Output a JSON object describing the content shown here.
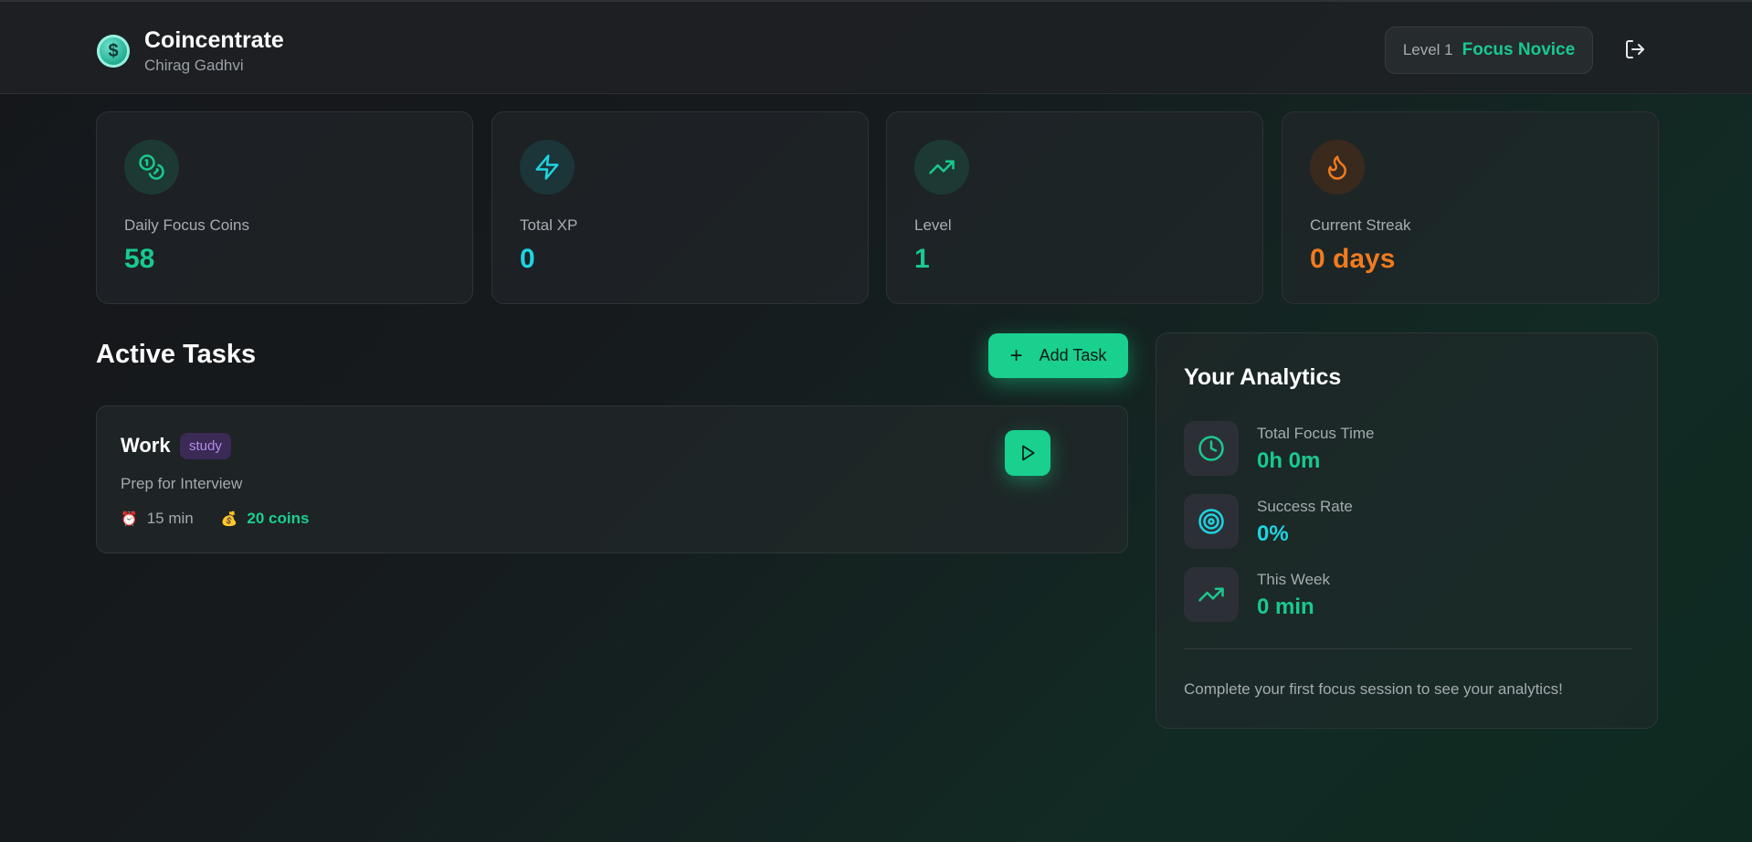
{
  "app": {
    "title": "Coincentrate",
    "user": "Chirag Gadhvi"
  },
  "header": {
    "level_label": "Level 1",
    "rank": "Focus Novice"
  },
  "stats": [
    {
      "label": "Daily Focus Coins",
      "value": "58",
      "color": "#19c98f",
      "icon": "coins-icon"
    },
    {
      "label": "Total XP",
      "value": "0",
      "color": "#1ed4e0",
      "icon": "lightning-icon"
    },
    {
      "label": "Level",
      "value": "1",
      "color": "#19c98f",
      "icon": "trending-up-icon"
    },
    {
      "label": "Current Streak",
      "value": "0 days",
      "color": "#f07b1e",
      "icon": "flame-icon"
    }
  ],
  "tasks_section": {
    "title": "Active Tasks",
    "add_label": "Add Task"
  },
  "tasks": [
    {
      "title": "Work",
      "tag": "study",
      "description": "Prep for Interview",
      "duration": "15 min",
      "coins": "20 coins"
    }
  ],
  "analytics": {
    "title": "Your Analytics",
    "metrics": [
      {
        "label": "Total Focus Time",
        "value": "0h 0m",
        "color": "#19c98f",
        "icon": "clock-icon"
      },
      {
        "label": "Success Rate",
        "value": "0%",
        "color": "#1ed4e0",
        "icon": "target-icon"
      },
      {
        "label": "This Week",
        "value": "0 min",
        "color": "#19c98f",
        "icon": "trending-up-icon"
      }
    ],
    "footer": "Complete your first focus session to see your analytics!"
  },
  "colors": {
    "accent": "#19d08f",
    "cyan": "#1ed4e0",
    "orange": "#f07b1e",
    "tag_bg": "#3b2a55",
    "tag_fg": "#b38be8"
  }
}
